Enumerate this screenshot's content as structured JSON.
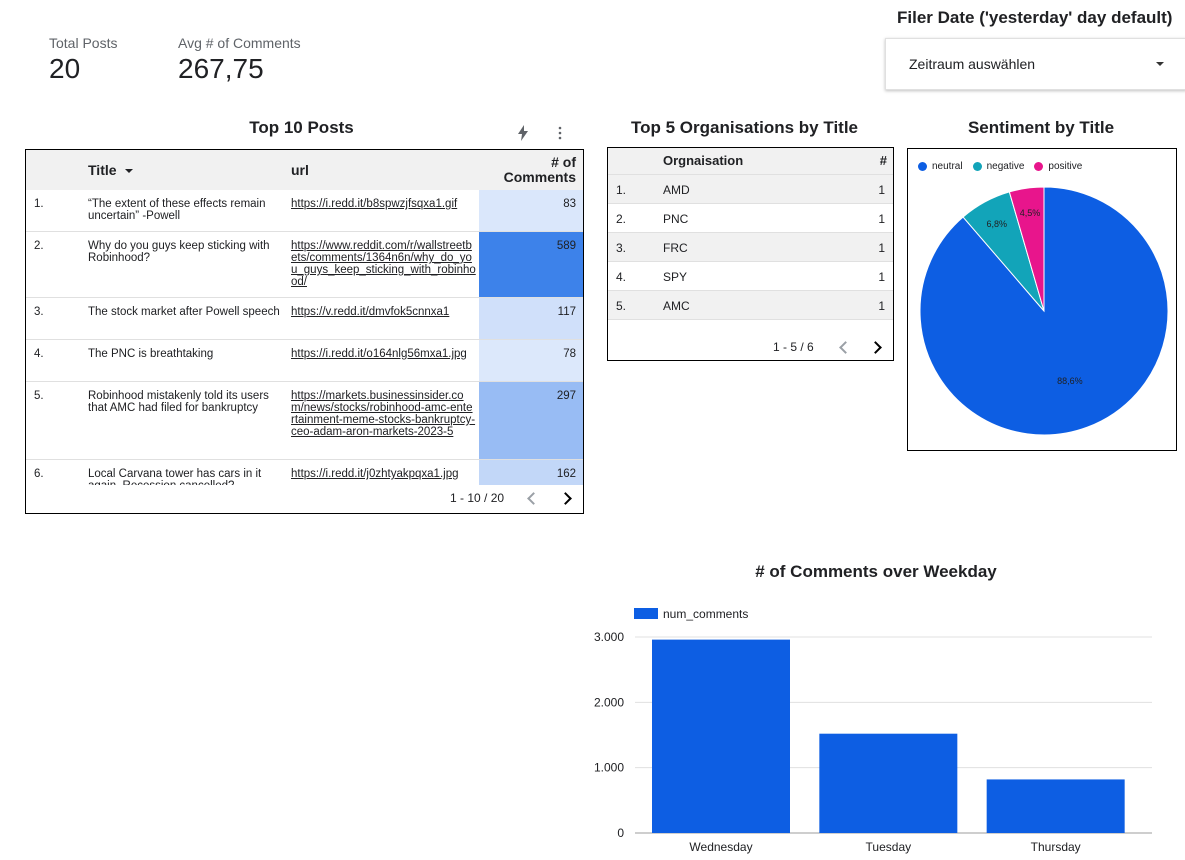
{
  "scorecards": [
    {
      "label": "Total Posts",
      "value": "20"
    },
    {
      "label": "Avg # of Comments",
      "value": "267,75"
    }
  ],
  "filter": {
    "title": "Filer Date ('yesterday' day default)",
    "placeholder": "Zeitraum auswählen"
  },
  "top_posts": {
    "title": "Top 10 Posts",
    "columns": {
      "title": "Title",
      "url": "url",
      "comments": "# of Comments"
    },
    "rows": [
      {
        "idx": "1.",
        "title": "“The extent of these effects remain uncertain” -Powell",
        "url": "https://i.redd.it/b8spwzjfsqxa1.gif",
        "comments": "83"
      },
      {
        "idx": "2.",
        "title": "Why do you guys keep sticking with Robinhood?",
        "url": "https://www.reddit.com/r/wallstreetbets/comments/1364n6n/why_do_you_guys_keep_sticking_with_robinhood/",
        "comments": "589"
      },
      {
        "idx": "3.",
        "title": "The stock market after Powell speech",
        "url": "https://v.redd.it/dmvfok5cnnxa1",
        "comments": "117"
      },
      {
        "idx": "4.",
        "title": "The PNC is breathtaking",
        "url": "https://i.redd.it/o164nlg56mxa1.jpg",
        "comments": "78"
      },
      {
        "idx": "5.",
        "title": "Robinhood mistakenly told its users that AMC had filed for bankruptcy",
        "url": "https://markets.businessinsider.com/news/stocks/robinhood-amc-entertainment-meme-stocks-bankruptcy-ceo-adam-aron-markets-2023-5",
        "comments": "297"
      },
      {
        "idx": "6.",
        "title": "Local Carvana tower has cars in it again. Recession cancelled?",
        "url": "https://i.redd.it/j0zhtyakpqxa1.jpg",
        "comments": "162"
      }
    ],
    "pager": "1 - 10 / 20"
  },
  "top_orgs": {
    "title": "Top 5 Organisations by Title",
    "columns": {
      "org": "Orgnaisation",
      "count": "#"
    },
    "rows": [
      {
        "idx": "1.",
        "org": "AMD",
        "count": "1"
      },
      {
        "idx": "2.",
        "org": "PNC",
        "count": "1"
      },
      {
        "idx": "3.",
        "org": "FRC",
        "count": "1"
      },
      {
        "idx": "4.",
        "org": "SPY",
        "count": "1"
      },
      {
        "idx": "5.",
        "org": "AMC",
        "count": "1"
      }
    ],
    "pager": "1 - 5 / 6"
  },
  "colors": {
    "bar": "#0d5ee3",
    "neutral": "#0d5ee3",
    "negative": "#12a4b9",
    "positive": "#e8158c",
    "heat_max": "#3d82ea",
    "heat_min": "#dce8fb"
  },
  "chart_data": [
    {
      "type": "pie",
      "title": "Sentiment by Title",
      "labels": [
        "neutral",
        "negative",
        "positive"
      ],
      "values": [
        88.6,
        6.8,
        4.5
      ],
      "value_labels": [
        "88,6%",
        "6,8%",
        "4,5%"
      ],
      "legend": "top-left"
    },
    {
      "type": "bar",
      "title": "# of Comments over Weekday",
      "categories": [
        "Wednesday",
        "Tuesday",
        "Thursday"
      ],
      "series": [
        {
          "name": "num_comments",
          "values": [
            2960,
            1520,
            820
          ]
        }
      ],
      "ylim": [
        0,
        3000
      ],
      "yticks": [
        "0",
        "1.000",
        "2.000",
        "3.000"
      ],
      "grid": true,
      "legend": "top-left"
    }
  ]
}
